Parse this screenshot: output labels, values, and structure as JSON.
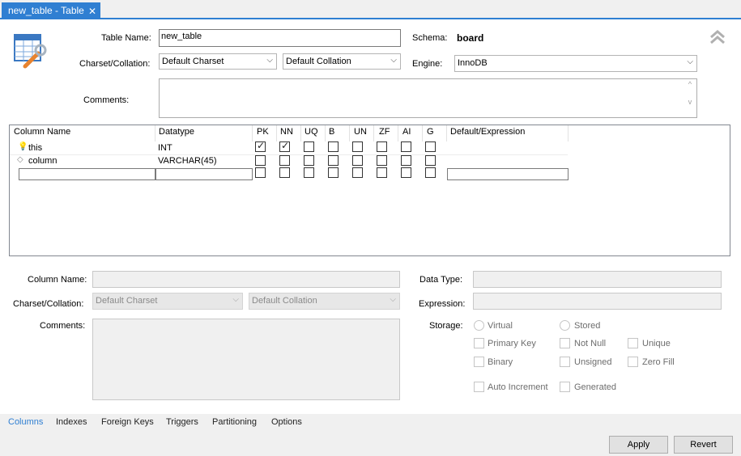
{
  "tab": {
    "title": "new_table - Table",
    "close": "✕"
  },
  "form": {
    "table_name_label": "Table Name:",
    "table_name_value": "new_table",
    "schema_label": "Schema:",
    "schema_value": "board",
    "charset_label": "Charset/Collation:",
    "charset_value": "Default Charset",
    "collation_value": "Default Collation",
    "engine_label": "Engine:",
    "engine_value": "InnoDB",
    "comments_label": "Comments:"
  },
  "grid": {
    "headers": [
      "Column Name",
      "Datatype",
      "PK",
      "NN",
      "UQ",
      "B",
      "UN",
      "ZF",
      "AI",
      "G",
      "Default/Expression"
    ],
    "rows": [
      {
        "name": "this",
        "type": "INT",
        "icon": "key-icon",
        "pk": true,
        "nn": true
      },
      {
        "name": "column",
        "type": "VARCHAR(45)",
        "icon": "diamond-icon",
        "pk": false,
        "nn": false
      }
    ]
  },
  "details": {
    "column_name_label": "Column Name:",
    "charset_label": "Charset/Collation:",
    "charset_value": "Default Charset",
    "collation_value": "Default Collation",
    "comments_label": "Comments:",
    "data_type_label": "Data Type:",
    "expression_label": "Expression:",
    "storage_label": "Storage:",
    "virtual": "Virtual",
    "stored": "Stored",
    "primary_key": "Primary Key",
    "not_null": "Not Null",
    "unique": "Unique",
    "binary": "Binary",
    "unsigned": "Unsigned",
    "zero_fill": "Zero Fill",
    "auto_increment": "Auto Increment",
    "generated": "Generated"
  },
  "bottom_tabs": [
    "Columns",
    "Indexes",
    "Foreign Keys",
    "Triggers",
    "Partitioning",
    "Options"
  ],
  "buttons": {
    "apply": "Apply",
    "revert": "Revert"
  },
  "colors": {
    "accent": "#2f7fd2"
  }
}
